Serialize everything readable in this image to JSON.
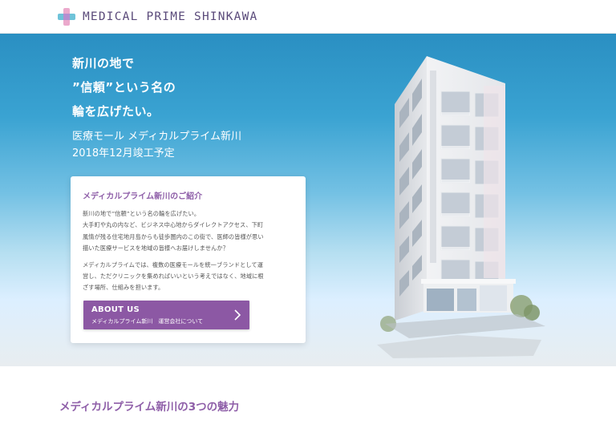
{
  "header": {
    "logo_text": "MEDICAL PRIME SHINKAWA"
  },
  "hero": {
    "headline_lines": [
      "新川の地で",
      "”信頼”という名の",
      "輪を広げたい。"
    ],
    "sub_lines": [
      "医療モール メディカルプライム新川",
      "2018年12月竣工予定"
    ]
  },
  "intro": {
    "title": "メディカルプライム新川のご紹介",
    "para1": [
      "新川の地で”信頼”という名の輪を広げたい。",
      "大手町や丸の内など、ビジネス中心地からダイレクトアクセス、下町",
      "風情が残る住宅地月島からも徒歩圏内のこの街で、医師の皆様が思い",
      "描いた医療サービスを地域の皆様へお届けしませんか？"
    ],
    "para2": [
      "メディカルプライムでは、複数の医療モールを統一ブランドとして運",
      "営し、ただクリニックを集めればいいという考えではなく、地域に根",
      "ざす場所、仕組みを担います。"
    ],
    "button": {
      "line1": "ABOUT US",
      "line2": "メディカルプライム新川　運営会社について"
    }
  },
  "features": {
    "title": "メディカルプライム新川の3つの魅力"
  },
  "colors": {
    "brand_purple": "#8c58a4",
    "sky_top": "#2a8fc2",
    "sky_bottom": "#e8edf0"
  },
  "icons": [
    "logo-cross-icon",
    "chevron-right-icon"
  ]
}
